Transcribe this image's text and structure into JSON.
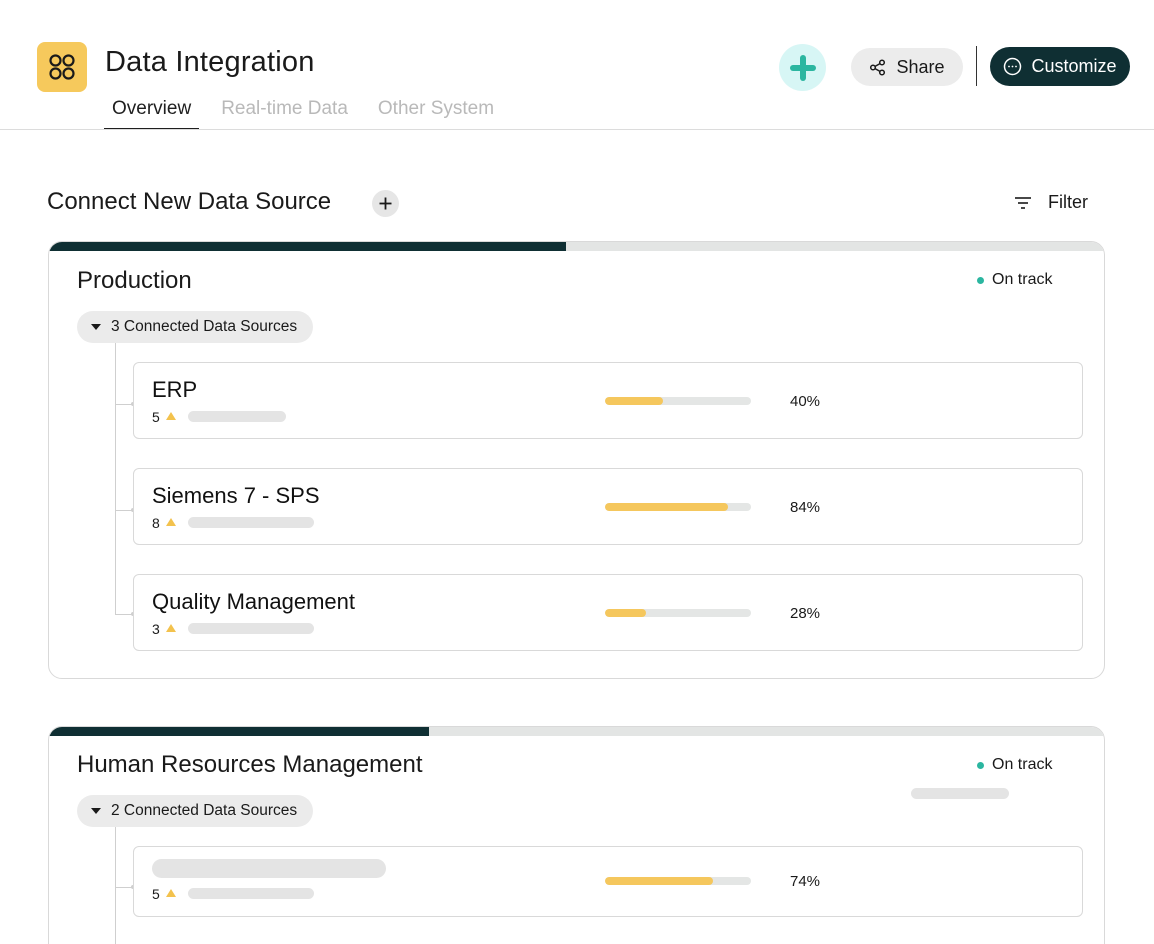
{
  "app": {
    "title": "Data Integration",
    "icon": "apps-grid-icon",
    "accent": "#f6c95c"
  },
  "tabs": [
    {
      "label": "Overview",
      "active": true
    },
    {
      "label": "Real-time Data",
      "active": false
    },
    {
      "label": "Other System",
      "active": false
    }
  ],
  "actions": {
    "share_label": "Share",
    "customize_label": "Customize",
    "primary_color": "#0f2f33",
    "badge_color": "#2bb6a0"
  },
  "section": {
    "title": "Connect New Data Source",
    "filter_label": "Filter"
  },
  "groups": [
    {
      "title": "Production",
      "status": "On track",
      "progress": 0.49,
      "connected_label": "3 Connected Data Sources",
      "sources": [
        {
          "name": "ERP",
          "count": "5",
          "percent": 40,
          "percent_label": "40%"
        },
        {
          "name": "Siemens 7 - SPS",
          "count": "8",
          "percent": 84,
          "percent_label": "84%"
        },
        {
          "name": "Quality Management",
          "count": "3",
          "percent": 28,
          "percent_label": "28%"
        }
      ]
    },
    {
      "title": "Human Resources Management",
      "status": "On track",
      "progress": 0.36,
      "connected_label": "2 Connected Data Sources",
      "sources": [
        {
          "name": "",
          "count": "5",
          "percent": 74,
          "percent_label": "74%"
        }
      ]
    }
  ]
}
